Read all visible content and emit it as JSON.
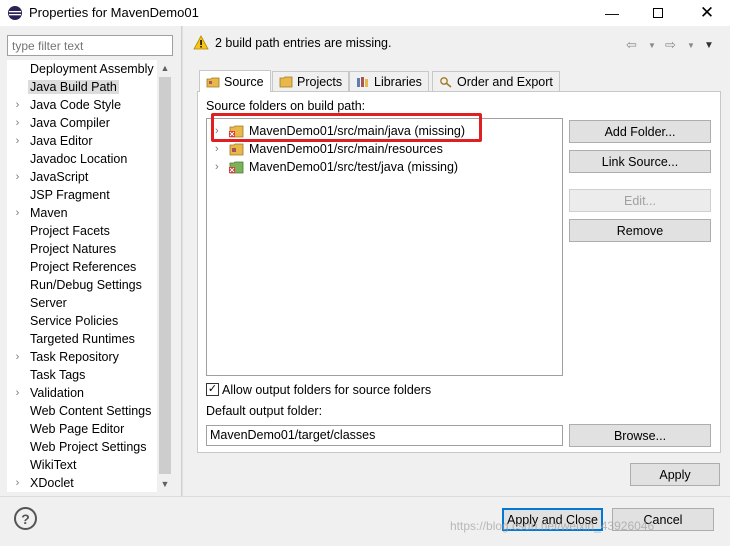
{
  "window": {
    "title": "Properties for MavenDemo01",
    "minimize_icon": "minimize-icon",
    "maximize_icon": "maximize-icon",
    "close_icon": "close-icon"
  },
  "filter": {
    "placeholder": "type filter text"
  },
  "nav": {
    "items": [
      {
        "label": "Deployment Assembly",
        "expandable": false
      },
      {
        "label": "Java Build Path",
        "expandable": false,
        "selected": true
      },
      {
        "label": "Java Code Style",
        "expandable": true
      },
      {
        "label": "Java Compiler",
        "expandable": true
      },
      {
        "label": "Java Editor",
        "expandable": true
      },
      {
        "label": "Javadoc Location",
        "expandable": false
      },
      {
        "label": "JavaScript",
        "expandable": true
      },
      {
        "label": "JSP Fragment",
        "expandable": false
      },
      {
        "label": "Maven",
        "expandable": true
      },
      {
        "label": "Project Facets",
        "expandable": false
      },
      {
        "label": "Project Natures",
        "expandable": false
      },
      {
        "label": "Project References",
        "expandable": false
      },
      {
        "label": "Run/Debug Settings",
        "expandable": false
      },
      {
        "label": "Server",
        "expandable": false
      },
      {
        "label": "Service Policies",
        "expandable": false
      },
      {
        "label": "Targeted Runtimes",
        "expandable": false
      },
      {
        "label": "Task Repository",
        "expandable": true
      },
      {
        "label": "Task Tags",
        "expandable": false
      },
      {
        "label": "Validation",
        "expandable": true
      },
      {
        "label": "Web Content Settings",
        "expandable": false
      },
      {
        "label": "Web Page Editor",
        "expandable": false
      },
      {
        "label": "Web Project Settings",
        "expandable": false
      },
      {
        "label": "WikiText",
        "expandable": false
      },
      {
        "label": "XDoclet",
        "expandable": true
      }
    ]
  },
  "header": {
    "message": "2 build path entries are missing."
  },
  "tabs": [
    {
      "label": "Source",
      "icon": "source-folder-icon",
      "active": true
    },
    {
      "label": "Projects",
      "icon": "projects-icon"
    },
    {
      "label": "Libraries",
      "icon": "libraries-icon"
    },
    {
      "label": "Order and Export",
      "icon": "order-export-icon"
    }
  ],
  "source": {
    "section_label": "Source folders on build path:",
    "folders": [
      {
        "label": "MavenDemo01/src/main/java (missing)",
        "missing": true
      },
      {
        "label": "MavenDemo01/src/main/resources",
        "missing": false
      },
      {
        "label": "MavenDemo01/src/test/java (missing)",
        "missing": true
      }
    ],
    "buttons": {
      "add_folder": "Add Folder...",
      "link_source": "Link Source...",
      "edit": "Edit...",
      "remove": "Remove"
    },
    "allow_output_label": "Allow output folders for source folders",
    "allow_output_checked": true,
    "default_output_label": "Default output folder:",
    "default_output_value": "MavenDemo01/target/classes",
    "browse": "Browse..."
  },
  "footer": {
    "apply": "Apply",
    "apply_close": "Apply and Close",
    "cancel": "Cancel"
  },
  "watermark": "https://blog.csdn.net/weixin_43926046",
  "colors": {
    "highlight": "#e02020",
    "default_button_border": "#0078d7"
  }
}
